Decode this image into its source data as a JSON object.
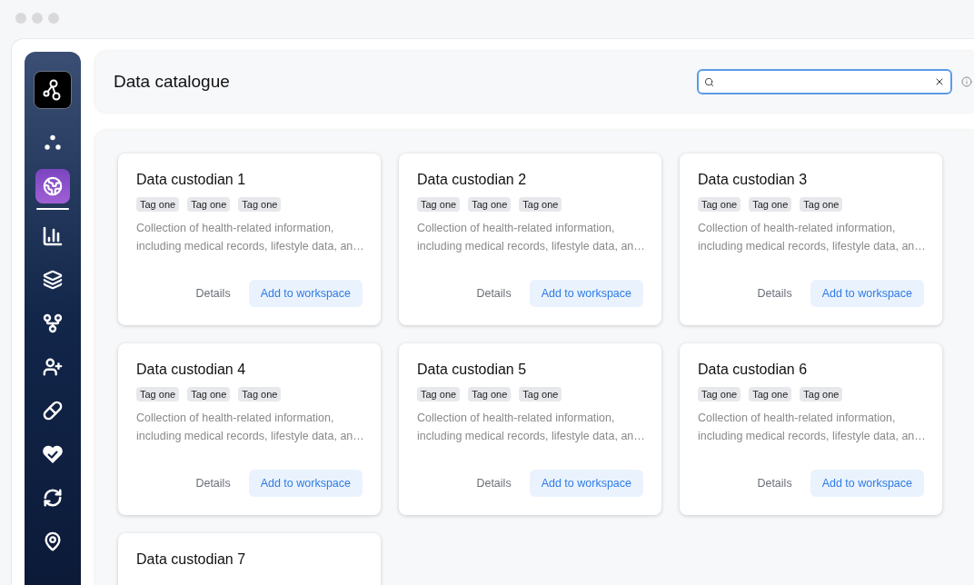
{
  "sidebar": {
    "items": [
      {
        "kind": "logo",
        "selected": false
      },
      {
        "kind": "dots",
        "selected": false
      },
      {
        "kind": "globe",
        "selected": true
      },
      {
        "kind": "chart",
        "selected": false
      },
      {
        "kind": "layers",
        "selected": false
      },
      {
        "kind": "branch",
        "selected": false
      },
      {
        "kind": "head",
        "selected": false
      },
      {
        "kind": "pill",
        "selected": false
      },
      {
        "kind": "heart",
        "selected": false
      },
      {
        "kind": "sync",
        "selected": false
      },
      {
        "kind": "pin",
        "selected": false
      }
    ]
  },
  "header": {
    "title": "Data catalogue"
  },
  "cards": [
    {
      "title": "Data custodian 1",
      "tags": [
        "Tag one",
        "Tag one",
        "Tag one"
      ],
      "description": "Collection of health-related information, including medical records, lifestyle data, an…",
      "buttons": [
        "Details",
        "Add to workspace"
      ]
    },
    {
      "title": "Data custodian 2",
      "tags": [
        "Tag one",
        "Tag one",
        "Tag one"
      ],
      "description": "Collection of health-related information, including medical records, lifestyle data, an…",
      "buttons": [
        "Details",
        "Add to workspace"
      ]
    },
    {
      "title": "Data custodian 3",
      "tags": [
        "Tag one",
        "Tag one",
        "Tag one"
      ],
      "description": "Collection of health-related information, including medical records, lifestyle data, an…",
      "buttons": [
        "Details",
        "Add to workspace"
      ]
    },
    {
      "title": "Data custodian 4",
      "tags": [
        "Tag one",
        "Tag one",
        "Tag one"
      ],
      "description": "Collection of health-related information, including medical records, lifestyle data, an…",
      "buttons": [
        "Details",
        "Add to workspace"
      ]
    },
    {
      "title": "Data custodian 5",
      "tags": [
        "Tag one",
        "Tag one",
        "Tag one"
      ],
      "description": "Collection of health-related information, including medical records, lifestyle data, an…",
      "buttons": [
        "Details",
        "Add to workspace"
      ]
    },
    {
      "title": "Data custodian 6",
      "tags": [
        "Tag one",
        "Tag one",
        "Tag one"
      ],
      "description": "Collection of health-related information, including medical records, lifestyle data, an…",
      "buttons": [
        "Details",
        "Add to workspace"
      ]
    },
    {
      "title": "Data custodian 7"
    }
  ]
}
